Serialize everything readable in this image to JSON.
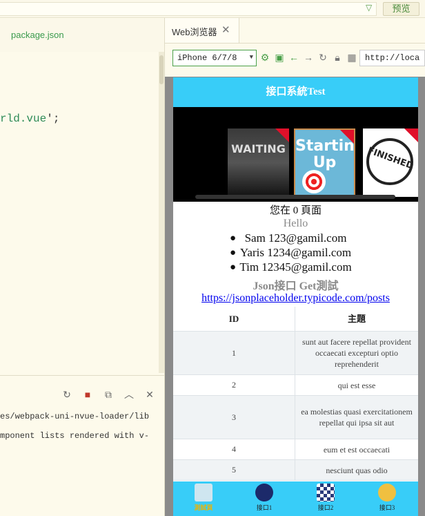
{
  "toolbar": {
    "filter_icon": "filter-icon",
    "preview_label": "预览"
  },
  "editor": {
    "tab_label": "package.json",
    "code_prefix": "rld.vue",
    "code_suffix": "';"
  },
  "console": {
    "icons": [
      "restart-icon",
      "stop-icon",
      "export-icon",
      "collapse-icon",
      "close-icon"
    ],
    "lines": [
      "es/webpack-uni-nvue-loader/lib",
      "mponent lists rendered with v-"
    ]
  },
  "browser": {
    "tab_label": "Web浏览器",
    "device": "iPhone 6/7/8",
    "url": "http://loca",
    "icons": [
      "settings-icon",
      "terminal-icon",
      "back-arrow-icon",
      "forward-arrow-icon",
      "refresh-icon",
      "lock-icon",
      "qrcode-icon"
    ]
  },
  "app": {
    "nav_title": "接口系統Test",
    "slides": [
      {
        "text": "WAITING"
      },
      {
        "text": "Starting Up"
      },
      {
        "text": "FINISHED"
      }
    ],
    "page_line": "您在 0 頁面",
    "hello": "Hello",
    "users": [
      {
        "name": "Sam",
        "email": "123@gamil.com"
      },
      {
        "name": "Yaris",
        "email": "1234@gamil.com"
      },
      {
        "name": "Tim",
        "email": "12345@gamil.com"
      }
    ],
    "json_title": "Json接口 Get測試",
    "link": "https://jsonplaceholder.typicode.com/posts",
    "table": {
      "headers": [
        "ID",
        "主題"
      ],
      "rows": [
        {
          "id": "1",
          "title": "sunt aut facere repellat provident occaecati excepturi optio reprehenderit"
        },
        {
          "id": "2",
          "title": "qui est esse"
        },
        {
          "id": "3",
          "title": "ea molestias quasi exercitationem repellat qui ipsa sit aut"
        },
        {
          "id": "4",
          "title": "eum et est occaecati"
        },
        {
          "id": "5",
          "title": "nesciunt quas odio"
        }
      ]
    },
    "tabs": [
      {
        "label": "測試頁",
        "icon": "paintbrush-icon",
        "active": true
      },
      {
        "label": "接口1",
        "icon": "astronaut-icon",
        "active": false
      },
      {
        "label": "接口2",
        "icon": "checkered-flag-icon",
        "active": false
      },
      {
        "label": "接口3",
        "icon": "rocket-icon",
        "active": false
      }
    ]
  },
  "colors": {
    "accent": "#38cdf8",
    "brand_green": "#4aa04a",
    "active_tab": "#e8b30a"
  }
}
